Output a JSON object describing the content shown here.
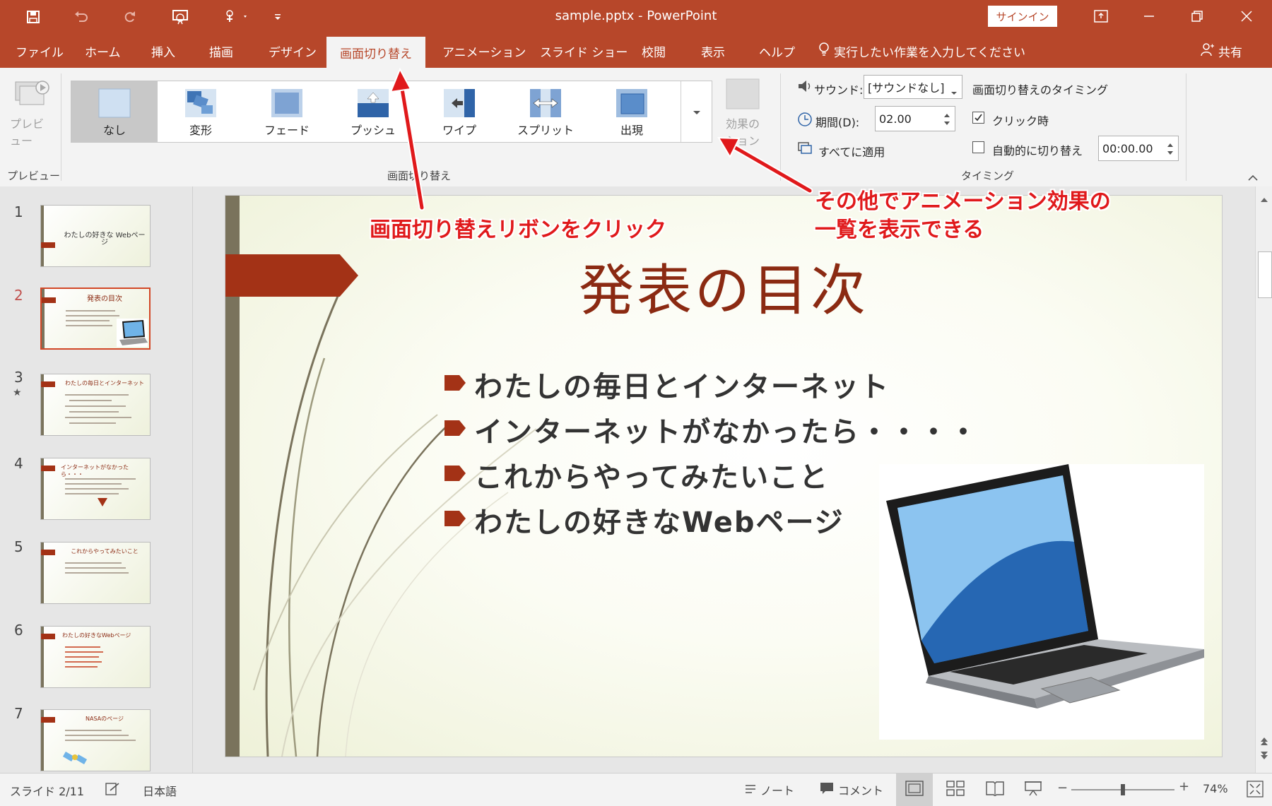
{
  "window": {
    "title": "sample.pptx  -  PowerPoint",
    "signin_label": "サインイン"
  },
  "quick_access": {
    "icons": [
      "save-icon",
      "undo-icon",
      "redo-icon",
      "start-from-beginning-icon",
      "touch-mode-icon",
      "customize-icon"
    ]
  },
  "tabs": [
    {
      "label": "ファイル"
    },
    {
      "label": "ホーム"
    },
    {
      "label": "挿入"
    },
    {
      "label": "描画"
    },
    {
      "label": "デザイン"
    },
    {
      "label": "画面切り替え",
      "active": true
    },
    {
      "label": "アニメーション"
    },
    {
      "label": "スライド ショー"
    },
    {
      "label": "校閲"
    },
    {
      "label": "表示"
    },
    {
      "label": "ヘルプ"
    }
  ],
  "tell_me": "実行したい作業を入力してください",
  "share": "共有",
  "ribbon": {
    "preview_button": "プレビュー",
    "preview_group": "プレビュー",
    "transitions_group": "画面切り替え",
    "gallery": [
      {
        "label": "なし",
        "selected": true
      },
      {
        "label": "変形"
      },
      {
        "label": "フェード"
      },
      {
        "label": "プッシュ"
      },
      {
        "label": "ワイプ"
      },
      {
        "label": "スプリット"
      },
      {
        "label": "出現"
      }
    ],
    "effect_options_line1": "効果の",
    "effect_options_line2": "ション",
    "sound_label": "サウンド:",
    "sound_value": "[サウンドなし]",
    "duration_label": "期間(D):",
    "duration_value": "02.00",
    "apply_all": "すべてに適用",
    "timing_heading": "画面切り替えのタイミング",
    "on_click": "クリック時",
    "on_click_checked": true,
    "after_label": "自動的に切り替え",
    "after_checked": false,
    "after_value": "00:00.00",
    "timing_group": "タイミング"
  },
  "thumbnails": [
    {
      "num": "1",
      "title": "わたしの好きな Webページ"
    },
    {
      "num": "2",
      "title": "発表の目次",
      "selected": true
    },
    {
      "num": "3",
      "title": "わたしの毎日とインターネット",
      "star": "★"
    },
    {
      "num": "4",
      "title": "インターネットがなかったら・・・"
    },
    {
      "num": "5",
      "title": "これからやってみたいこと"
    },
    {
      "num": "6",
      "title": "わたしの好きなWebページ"
    },
    {
      "num": "7",
      "title": "NASAのページ"
    }
  ],
  "slide": {
    "title": "発表の目次",
    "bullets": [
      "わたしの毎日とインターネット",
      "インターネットがなかったら・・・・",
      "これからやってみたいこと",
      "わたしの好きなWebページ"
    ]
  },
  "annotations": {
    "ribbon_click": "画面切り替えリボンをクリック",
    "more_line1": "その他でアニメーション効果の",
    "more_line2": "一覧を表示できる"
  },
  "status": {
    "slide_indicator": "スライド 2/11",
    "language": "日本語",
    "notes": "ノート",
    "comments": "コメント",
    "zoom": "74%",
    "zoom_fraction": 0.5
  },
  "colors": {
    "accent": "#b7472a",
    "slide_title": "#8b2a12",
    "annotation": "#e0191b"
  }
}
